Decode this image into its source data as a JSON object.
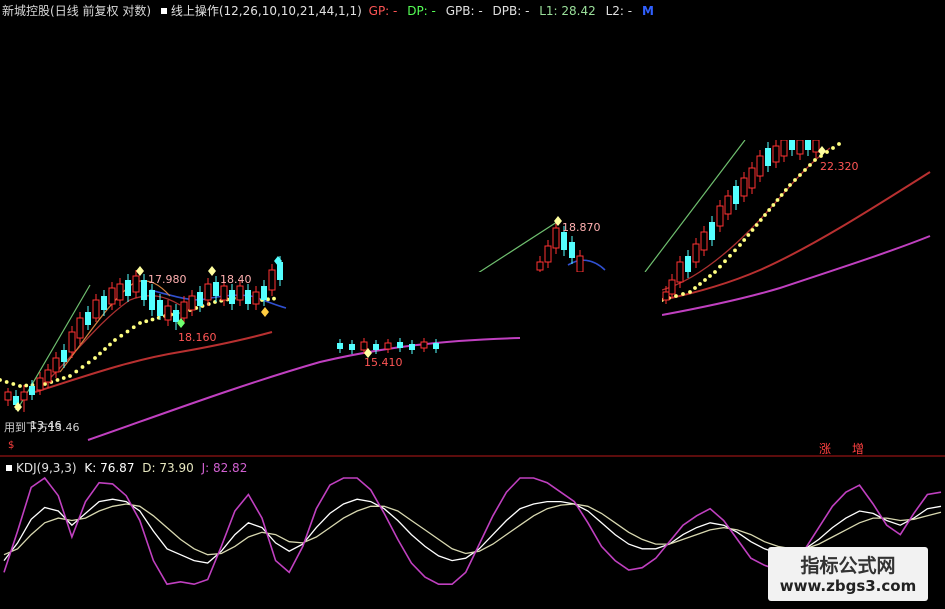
{
  "main_panel": {
    "stock": "新城控股",
    "period": "(日线 前复权 对数)",
    "indicator": "线上操作",
    "params": "(12,26,10,10,21,44,1,1)",
    "gp": "GP: -",
    "dp": "DP: -",
    "gpb": "GPB: -",
    "dpb": "DPB: -",
    "l1": "L1: 28.42",
    "l2": "L2: -",
    "m_icon": "M",
    "low_label": "用到下方13.46",
    "small_mark": "$",
    "zhang": "涨",
    "zeng": "增"
  },
  "kdj_panel": {
    "title": "KDJ(9,3,3)",
    "k": "K: 76.87",
    "d": "D: 73.90",
    "j": "J: 82.82"
  },
  "watermark": {
    "title": "指标公式网",
    "url": "www.zbgs3.com"
  },
  "colors": {
    "background": "#000000",
    "candle_up": "#ff3232",
    "candle_down": "#54ffff",
    "ma_dotted": "#ffff80",
    "ma_red": "#c03030",
    "ma_purple": "#c040c0",
    "ma_blue": "#3050d0",
    "trend_green": "#70c070",
    "k_line": "#ffffff",
    "d_line": "#d8d8b0",
    "j_line": "#c040c0",
    "label_red": "#ff5555"
  },
  "chart_data": [
    {
      "type": "line",
      "title": "新城控股 线上操作",
      "annotations": [
        "13.46",
        "18.160",
        "17.980",
        "18.40",
        "15.410",
        "18.870",
        "22.320"
      ],
      "series": [
        {
          "name": "线上操作",
          "x": [
            0,
            20,
            45,
            70,
            100,
            140,
            180,
            220,
            260,
            280
          ],
          "y": [
            13.6,
            13.5,
            13.9,
            14.6,
            15.6,
            16.8,
            17.4,
            17.8,
            18.0,
            18.2
          ]
        }
      ]
    },
    {
      "type": "line",
      "title": "KDJ(9,3,3)",
      "ylim": [
        0,
        100
      ],
      "series": [
        {
          "name": "K",
          "values": [
            30,
            45,
            65,
            75,
            72,
            60,
            70,
            80,
            82,
            80,
            72,
            55,
            40,
            35,
            30,
            28,
            38,
            52,
            62,
            58,
            45,
            38,
            44,
            58,
            70,
            78,
            82,
            80,
            74,
            64,
            52,
            42,
            34,
            30,
            32,
            40,
            52,
            64,
            74,
            78,
            80,
            80,
            78,
            72,
            62,
            52,
            44,
            40,
            40,
            44,
            52,
            58,
            62,
            60,
            54,
            46,
            40,
            36,
            36,
            40,
            48,
            58,
            66,
            72,
            70,
            64,
            60,
            66,
            74,
            76
          ]
        },
        {
          "name": "D",
          "values": [
            35,
            40,
            52,
            62,
            66,
            64,
            66,
            72,
            76,
            78,
            76,
            68,
            58,
            48,
            40,
            35,
            36,
            42,
            50,
            54,
            52,
            46,
            45,
            50,
            58,
            66,
            72,
            76,
            76,
            72,
            64,
            56,
            48,
            40,
            36,
            38,
            44,
            52,
            60,
            68,
            74,
            77,
            78,
            76,
            70,
            62,
            54,
            48,
            44,
            44,
            48,
            52,
            56,
            58,
            56,
            52,
            46,
            42,
            40,
            40,
            44,
            50,
            56,
            62,
            66,
            66,
            64,
            65,
            68,
            71
          ]
        },
        {
          "name": "J",
          "values": [
            20,
            55,
            92,
            100,
            85,
            50,
            80,
            96,
            95,
            85,
            64,
            30,
            10,
            12,
            10,
            14,
            42,
            72,
            86,
            66,
            30,
            20,
            42,
            74,
            94,
            100,
            100,
            90,
            70,
            48,
            28,
            16,
            10,
            10,
            20,
            44,
            68,
            88,
            100,
            100,
            96,
            88,
            80,
            62,
            42,
            30,
            22,
            24,
            32,
            46,
            60,
            68,
            74,
            64,
            48,
            32,
            26,
            22,
            26,
            40,
            58,
            76,
            88,
            94,
            78,
            60,
            52,
            70,
            86,
            88
          ]
        }
      ]
    }
  ]
}
